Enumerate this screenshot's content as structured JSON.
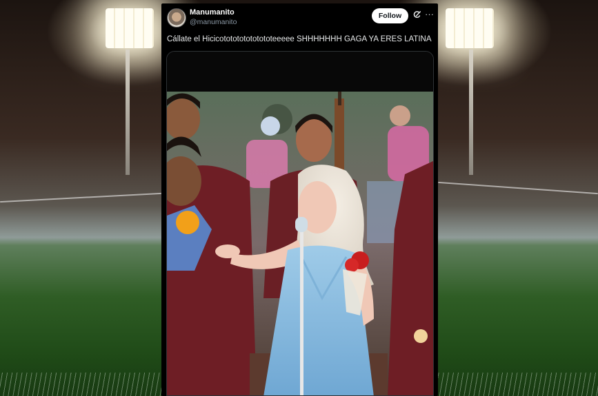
{
  "post": {
    "author_name": "Manumanito",
    "author_handle": "@manumanito",
    "follow_label": "Follow",
    "more_label": "···",
    "text": "Cállate el Hicicototototototototeeeee SHHHHHHH GAGA YA ERES LATINA"
  },
  "icons": {
    "grok": "grok-icon",
    "more": "more-icon"
  },
  "colors": {
    "background": "#000000",
    "follow_bg": "#ffffff",
    "text": "#e7e9ea",
    "handle": "#8b98a5"
  }
}
